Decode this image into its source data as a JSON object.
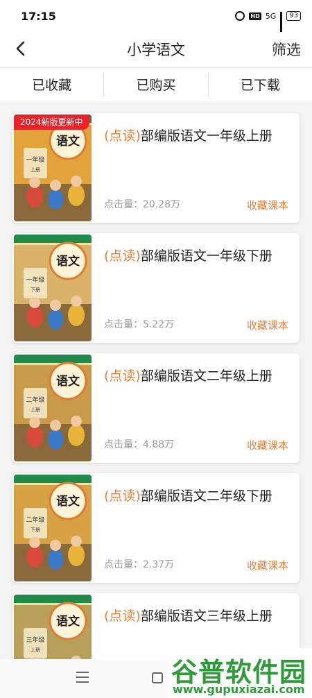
{
  "status": {
    "time": "17:15",
    "hd": "HD",
    "network": "5G",
    "battery": "93"
  },
  "nav": {
    "title": "小学语文",
    "filter_label": "筛选"
  },
  "tabs": [
    {
      "label": "已收藏"
    },
    {
      "label": "已购买"
    },
    {
      "label": "已下载"
    }
  ],
  "books": [
    {
      "badge": "2024新版更新中",
      "title_prefix": "(点读)",
      "title": "部编版语文一年级上册",
      "clicks": "点击量：20.28万",
      "favorite": "收藏课本",
      "cover_grade": "一年级",
      "cover_term": "上册",
      "cover_brand": "语文",
      "cover_color": "#e2a33a"
    },
    {
      "title_prefix": "(点读)",
      "title": "部编版语文一年级下册",
      "clicks": "点击量：5.22万",
      "favorite": "收藏课本",
      "cover_grade": "一年级",
      "cover_term": "下册",
      "cover_brand": "语文",
      "cover_color": "#d9b36a"
    },
    {
      "title_prefix": "(点读)",
      "title": "部编版语文二年级上册",
      "clicks": "点击量：4.88万",
      "favorite": "收藏课本",
      "cover_grade": "二年级",
      "cover_term": "上册",
      "cover_brand": "语文",
      "cover_color": "#c89a4a"
    },
    {
      "title_prefix": "(点读)",
      "title": "部编版语文二年级下册",
      "clicks": "点击量：2.37万",
      "favorite": "收藏课本",
      "cover_grade": "二年级",
      "cover_term": "下册",
      "cover_brand": "语文",
      "cover_color": "#d6a244"
    },
    {
      "title_prefix": "(点读)",
      "title": "部编版语文三年级上册",
      "clicks": "",
      "favorite": "",
      "cover_grade": "三年级",
      "cover_term": "上册",
      "cover_brand": "语文",
      "cover_color": "#b9a05a"
    }
  ],
  "watermark": {
    "main": "谷普软件园",
    "url": "www.gupuxiazai.com"
  }
}
